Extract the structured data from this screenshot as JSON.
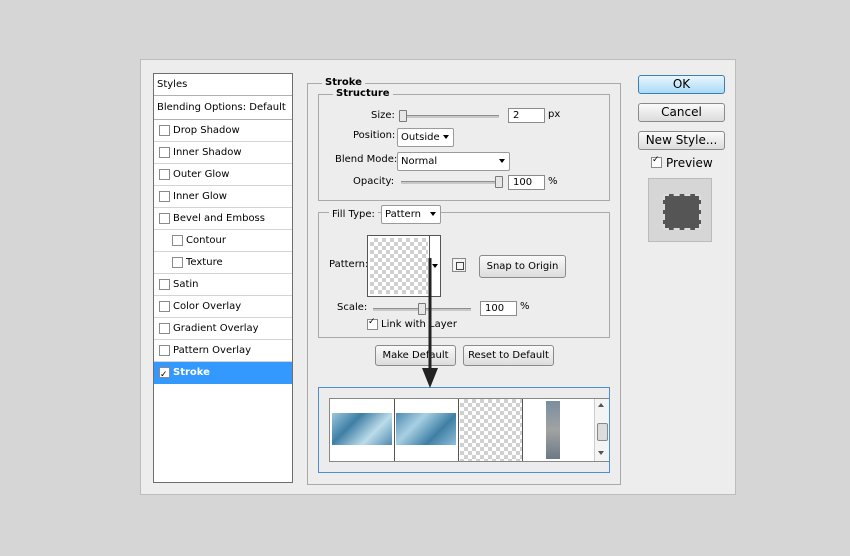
{
  "styles_panel": {
    "header": "Styles",
    "blending": "Blending Options: Default",
    "items": [
      {
        "label": "Drop Shadow",
        "checked": false,
        "indent": false
      },
      {
        "label": "Inner Shadow",
        "checked": false,
        "indent": false
      },
      {
        "label": "Outer Glow",
        "checked": false,
        "indent": false
      },
      {
        "label": "Inner Glow",
        "checked": false,
        "indent": false
      },
      {
        "label": "Bevel and Emboss",
        "checked": false,
        "indent": false
      },
      {
        "label": "Contour",
        "checked": false,
        "indent": true
      },
      {
        "label": "Texture",
        "checked": false,
        "indent": true
      },
      {
        "label": "Satin",
        "checked": false,
        "indent": false
      },
      {
        "label": "Color Overlay",
        "checked": false,
        "indent": false
      },
      {
        "label": "Gradient Overlay",
        "checked": false,
        "indent": false
      },
      {
        "label": "Pattern Overlay",
        "checked": false,
        "indent": false
      },
      {
        "label": "Stroke",
        "checked": true,
        "indent": false,
        "selected": true
      }
    ]
  },
  "stroke": {
    "title": "Stroke",
    "structure": {
      "title": "Structure",
      "size_label": "Size:",
      "size_value": "2",
      "size_unit": "px",
      "position_label": "Position:",
      "position_value": "Outside",
      "blend_label": "Blend Mode:",
      "blend_value": "Normal",
      "opacity_label": "Opacity:",
      "opacity_value": "100",
      "opacity_unit": "%"
    },
    "fill": {
      "type_label": "Fill Type:",
      "type_value": "Pattern",
      "pattern_label": "Pattern:",
      "snap_button": "Snap to Origin",
      "scale_label": "Scale:",
      "scale_value": "100",
      "scale_unit": "%",
      "link_label": "Link with Layer",
      "link_checked": true
    },
    "make_default": "Make Default",
    "reset_default": "Reset to Default"
  },
  "buttons": {
    "ok": "OK",
    "cancel": "Cancel",
    "new_style": "New Style...",
    "preview_label": "Preview",
    "preview_checked": true
  },
  "colors": {
    "selection": "#3399ff",
    "preview_swatch": "#555555",
    "ok_border": "#3c7fb1"
  }
}
